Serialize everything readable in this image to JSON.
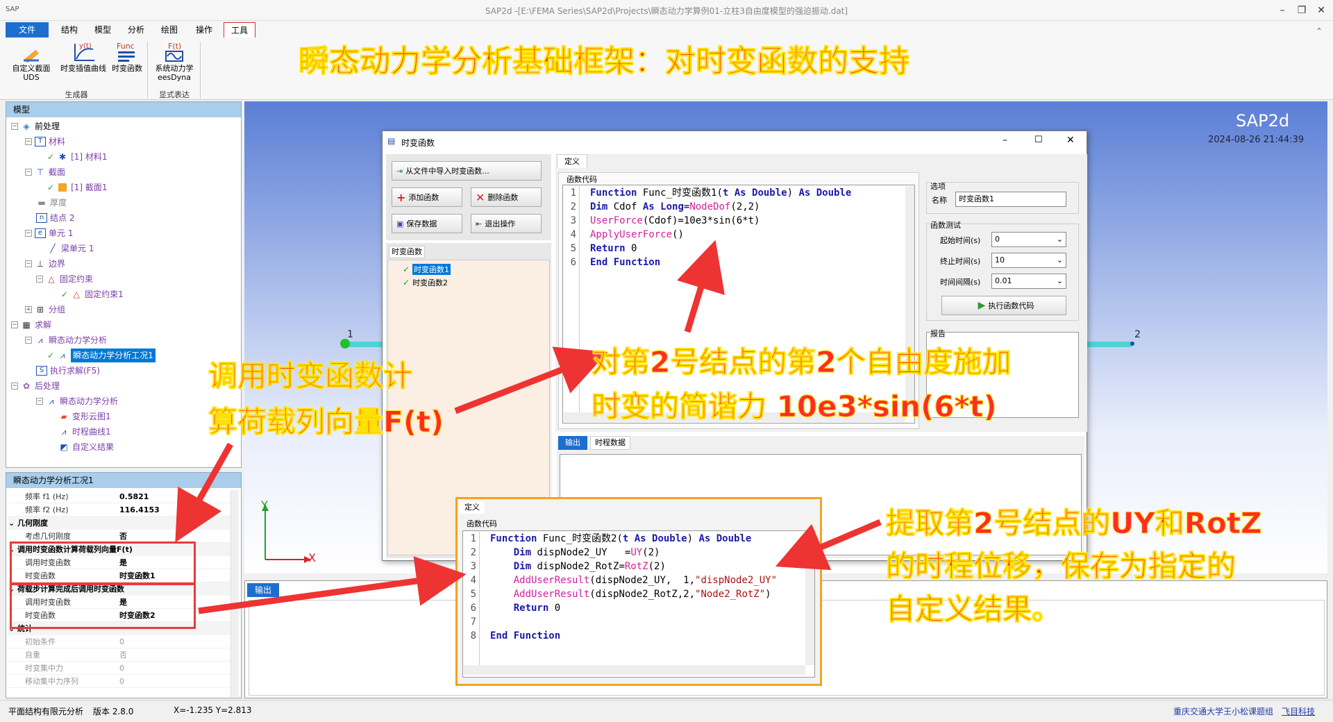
{
  "window": {
    "title": "SAP2d -[E:\\FEMA Series\\SAP2d\\Projects\\瞬态动力学算例01-立柱3自由度模型的强迫振动.dat]",
    "app_icon": "SAP"
  },
  "menu": [
    "文件",
    "结构",
    "模型",
    "分析",
    "绘图",
    "操作",
    "工具"
  ],
  "ribbon": {
    "buttons": [
      {
        "label": "自定义截面\nUDS",
        "icon": "ruler-icon"
      },
      {
        "label": "时变插值曲线",
        "icon": "curve-icon"
      },
      {
        "label": "时变函数",
        "icon": "func-icon"
      },
      {
        "label": "系统动力学\neesDyna",
        "icon": "ft-icon"
      }
    ],
    "icon_text": {
      "yt": "y(t)",
      "func": "Func",
      "ft": "F(t)"
    },
    "groups": [
      "生成器",
      "显式表达"
    ]
  },
  "headline": "瞬态动力学分析基础框架：对时变函数的支持",
  "model_panel": {
    "title": "模型",
    "tree": [
      "前处理",
      "材料",
      "[1] 材料1",
      "截面",
      "[1] 截面1",
      "厚度",
      "结点 2",
      "单元 1",
      "梁单元 1",
      "边界",
      "固定约束",
      "固定约束1",
      "分组",
      "求解",
      "瞬态动力学分析",
      "瞬态动力学分析工况1",
      "执行求解(F5)",
      "后处理",
      "瞬态动力学分析",
      "变形云图1",
      "时程曲线1",
      "自定义结果"
    ]
  },
  "props_panel": {
    "title": "瞬态动力学分析工况1",
    "rows": [
      {
        "k": "频率 f1 (Hz)",
        "v": "0.5821"
      },
      {
        "k": "频率 f2 (Hz)",
        "v": "116.4153"
      },
      {
        "cat": "几何刚度"
      },
      {
        "k": "考虑几何刚度",
        "v": "否"
      },
      {
        "cat": "调用时变函数计算荷载列向量F(t)"
      },
      {
        "k": "调用时变函数",
        "v": "是"
      },
      {
        "k": "时变函数",
        "v": "时变函数1"
      },
      {
        "cat": "荷载步计算完成后调用时变函数"
      },
      {
        "k": "调用时变函数",
        "v": "是"
      },
      {
        "k": "时变函数",
        "v": "时变函数2"
      },
      {
        "cat": "统计"
      },
      {
        "k": "初始条件",
        "v": "0"
      },
      {
        "k": "自重",
        "v": "否"
      },
      {
        "k": "时变集中力",
        "v": "0"
      },
      {
        "k": "移动集中力序列",
        "v": "0"
      }
    ]
  },
  "viewport": {
    "brand": "SAP2d",
    "datetime": "2024-08-26 21:44:39",
    "node1": "1",
    "node2": "2",
    "axis_y": "Y",
    "axis_x": "X"
  },
  "dialog": {
    "title": "时变函数",
    "buttons": {
      "import": "从文件中导入时变函数...",
      "add": "添加函数",
      "delete": "删除函数",
      "save": "保存数据",
      "exit": "退出操作"
    },
    "list_title": "时变函数",
    "functions": [
      "时变函数1",
      "时变函数2"
    ],
    "tab": "定义",
    "code_label": "函数代码",
    "options_label": "选项",
    "name_label": "名称",
    "name_value": "时变函数1",
    "test_label": "函数测试",
    "start_label": "起始时间(s)",
    "start_value": "0",
    "end_label": "终止时间(s)",
    "end_value": "10",
    "step_label": "时间间隔(s)",
    "step_value": "0.01",
    "run_label": "执行函数代码",
    "report_label": "报告",
    "out_tabs": [
      "输出",
      "时程数据"
    ],
    "code_lines": [
      "1",
      "2",
      "3",
      "4",
      "5",
      "6"
    ]
  },
  "dialog2": {
    "tab": "定义",
    "code_label": "函数代码",
    "code_lines": [
      "1",
      "2",
      "3",
      "4",
      "5",
      "6",
      "7",
      "8"
    ]
  },
  "output": {
    "tab": "输出"
  },
  "callouts": {
    "c1a": "对第2号结点的第2个自由度施加",
    "c1b": "时变的简谐力 10e3*sin(6*t)",
    "c2a": "调用时变函数计",
    "c2b": "算荷载列向量F(t)",
    "c3a": "提取第2号结点的UY和RotZ",
    "c3b": "的时程位移，保存为指定的",
    "c3c": "自定义结果。"
  },
  "status": {
    "mode": "平面结构有限元分析",
    "version": "版本 2.8.0",
    "coords": "X=-1.235  Y=2.813",
    "credit1": "重庆交通大学王小松课题组",
    "credit2": "飞目科技"
  }
}
